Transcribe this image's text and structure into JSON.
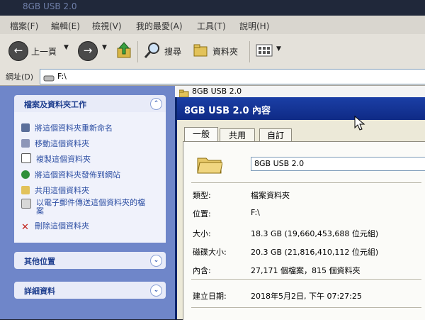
{
  "window": {
    "title": "8GB USB 2.0"
  },
  "menu": [
    "檔案(F)",
    "編輯(E)",
    "檢視(V)",
    "我的最愛(A)",
    "工具(T)",
    "說明(H)"
  ],
  "toolbar": {
    "back_label": "上一頁",
    "search_label": "搜尋",
    "folders_label": "資料夾"
  },
  "address": {
    "label": "網址(D)",
    "value": "F:\\"
  },
  "tasks_panel": {
    "title": "檔案及資料夾工作",
    "items": [
      "將這個資料夾重新命名",
      "移動這個資料夾",
      "複製這個資料夾",
      "將這個資料夾發佈到網站",
      "共用這個資料夾",
      "以電子郵件傳送這個資料夾的檔案",
      "刪除這個資料夾"
    ]
  },
  "other_places": {
    "title": "其他位置"
  },
  "details": {
    "title": "詳細資料"
  },
  "file_list": {
    "item": "8GB USB 2.0"
  },
  "dialog": {
    "title": "8GB USB 2.0 內容",
    "tabs": [
      "一般",
      "共用",
      "自訂"
    ],
    "name_value": "8GB USB 2.0",
    "props": [
      {
        "label": "類型:",
        "value": "檔案資料夾"
      },
      {
        "label": "位置:",
        "value": "F:\\"
      },
      {
        "label": "大小:",
        "value": "18.3 GB (19,660,453,688 位元組)"
      },
      {
        "label": "磁碟大小:",
        "value": "20.3 GB (21,816,410,112 位元組)"
      },
      {
        "label": "內含:",
        "value": "27,171 個檔案，815 個資料夾"
      },
      {
        "label": "建立日期:",
        "value": "2018年5月2日, 下午 07:27:25"
      }
    ]
  },
  "colors": {
    "title_bar": "#1b3fa6",
    "task_pane": "#6f86c9",
    "link": "#2c4ea3"
  }
}
